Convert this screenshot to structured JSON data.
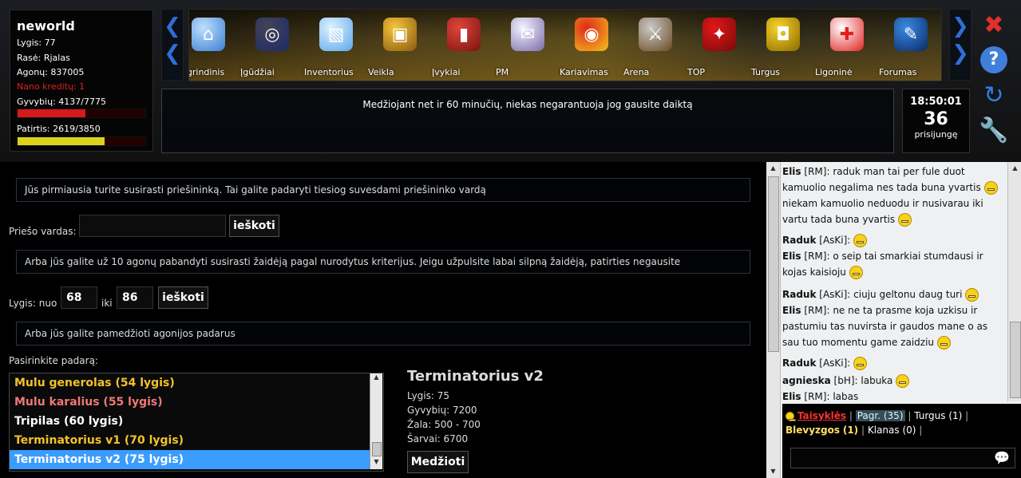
{
  "player": {
    "name": "neworld",
    "level": "Lygis: 77",
    "race": "Rasė: Rjalas",
    "agonai": "Agonų: 837005",
    "nano": "Nano kreditų: 1",
    "hp": "Gyvybių: 4137/7775",
    "hp_fraction": 0.532,
    "xp": "Patirtis: 2619/3850",
    "xp_fraction": 0.68
  },
  "nav": {
    "items": [
      {
        "label": "Pagrindinis",
        "icon": "home-icon"
      },
      {
        "label": "Įgūdžiai",
        "icon": "skills-icon"
      },
      {
        "label": "Inventorius",
        "icon": "box-icon"
      },
      {
        "label": "Veikla",
        "icon": "treasure-chest-icon"
      },
      {
        "label": "Įvykiai",
        "icon": "book-icon"
      },
      {
        "label": "PM",
        "icon": "mail-icon"
      },
      {
        "label": "Kariavimas",
        "icon": "target-icon"
      },
      {
        "label": "Arena",
        "icon": "crossed-swords-icon"
      },
      {
        "label": "TOP",
        "icon": "award-ribbon-icon"
      },
      {
        "label": "Turgus",
        "icon": "shopping-bag-icon"
      },
      {
        "label": "Ligoninė",
        "icon": "medical-cross-icon"
      },
      {
        "label": "Forumas",
        "icon": "pen-icon"
      }
    ]
  },
  "news": "Medžiojant net ir 60 minučių, niekas negarantuoja jog gausite daiktą",
  "clock": {
    "time": "18:50:01",
    "online_count": "36",
    "online_label": "prisijungę"
  },
  "colors": {
    "hp_bar": "#d41a1a",
    "xp_bar": "#dcd21c",
    "nano": "#e02020",
    "selected": "#3b9cff",
    "yellow_mon": "#f3c22a",
    "red_mon": "#f07878"
  },
  "hunt": {
    "info1": "Jūs pirmiausia turite susirasti priešininką. Tai galite padaryti tiesiog suvesdami priešininko vardą",
    "enemy_label": "Priešo vardas:",
    "enemy_value": "",
    "search_btn": "ieškoti",
    "info2": "Arba jūs galite už 10 agonų pabandyti susirasti žaidėją pagal nurodytus kriterijus. Jeigu užpulsite labai silpną žaidėją, patirties negausite",
    "level_label": "Lygis: nuo",
    "level_from": "68",
    "level_to_label": "iki",
    "level_to": "86",
    "search_btn2": "ieškoti",
    "info3": "Arba jūs galite pamedžioti agonijos padarus",
    "choose_label": "Pasirinkite padarą:",
    "monsters": [
      {
        "label": "Mulu generolas (54 lygis)",
        "color": "#f3c22a"
      },
      {
        "label": "Mulu karalius (55 lygis)",
        "color": "#f07878"
      },
      {
        "label": "Tripilas (60 lygis)",
        "color": "#ffffff"
      },
      {
        "label": "Terminatorius v1 (70 lygis)",
        "color": "#f3c22a"
      },
      {
        "label": "Terminatorius v2 (75 lygis)",
        "color": "#ffffff"
      }
    ],
    "selected_index": 4,
    "creature": {
      "name": "Terminatorius v2",
      "level": "Lygis: 75",
      "hp": "Gyvybių: 7200",
      "damage": "Žala: 500 - 700",
      "armor": "Šarvai: 6700",
      "hunt_btn": "Medžioti"
    }
  },
  "chat": {
    "messages": [
      {
        "user": "Elis",
        "tag": " [RM]: ",
        "text": "raduk man tai per fule duot kamuolio negalima nes tada buna yvartis",
        "smile": true,
        "text2": " niekam kamuolio neduodu ir nusivarau iki vartu tada buna yvartis",
        "smile2": true
      },
      {
        "user": "Raduk",
        "tag": " [AsKi]: ",
        "text": "",
        "smile": true
      },
      {
        "user": "Elis",
        "tag": " [RM]: ",
        "text": "o seip tai smarkiai stumdausi ir kojas kaisioju",
        "smile": true
      },
      {
        "user": "Raduk",
        "tag": " [AsKi]: ",
        "text": "ciuju geltonu daug turi",
        "smile": true
      },
      {
        "user": "Elis",
        "tag": " [RM]: ",
        "text": "ne ne ta prasme koja uzkisu ir pastumiu tas nuvirsta ir gaudos mane o as sau tuo momentu game zaidziu",
        "smile": true
      },
      {
        "user": "Raduk",
        "tag": " [AsKi]: ",
        "text": "",
        "smile": true
      },
      {
        "user": "agnieska",
        "tag": " [bH]: ",
        "text": "labuka",
        "smile": true
      },
      {
        "user": "Elis",
        "tag": " [RM]: ",
        "text": "labas",
        "smile": false
      }
    ],
    "tabs": {
      "rules": "Taisyklės",
      "main": "Pagr. (35)",
      "market": "Turgus (1)",
      "spam": "Blevyzgos",
      "spam_count": "(1)",
      "clan": "Klanas (0)"
    }
  }
}
